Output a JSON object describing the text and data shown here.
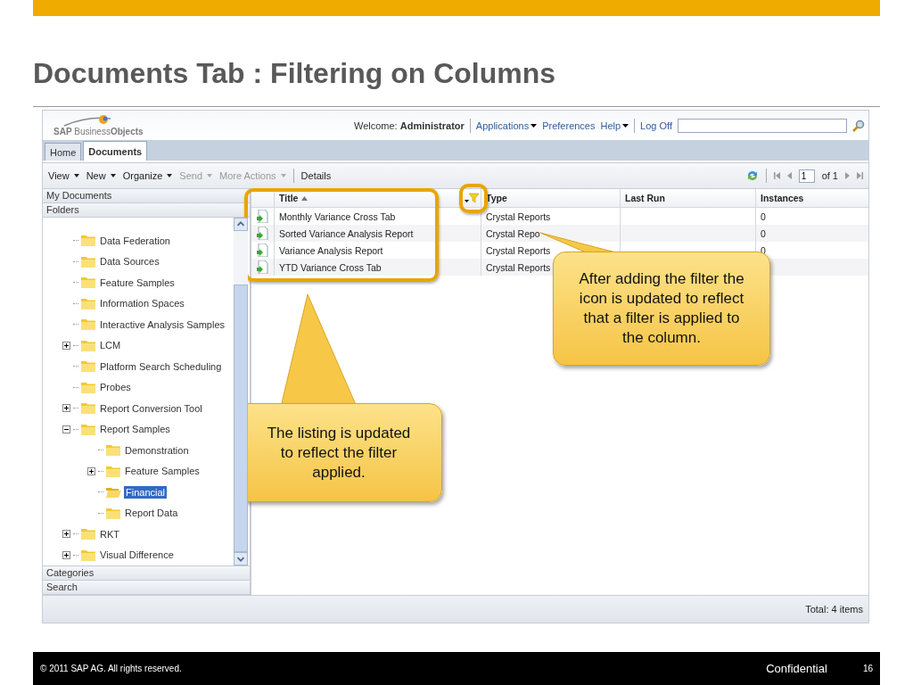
{
  "slide": {
    "title": "Documents Tab : Filtering on Columns"
  },
  "app": {
    "logo": "**SAP** Business**Objects**",
    "welcome": "Welcome: **Administrator**",
    "links": [
      {
        "label": "Applications",
        "menu": true
      },
      {
        "label": "Preferences",
        "menu": false
      },
      {
        "label": "Help",
        "menu": true
      },
      {
        "label": "Log Off",
        "menu": false
      }
    ],
    "tabs": [
      {
        "label": "Home",
        "selected": false
      },
      {
        "label": "Documents",
        "selected": true
      }
    ],
    "toolbar": {
      "actions": [
        {
          "label": "View",
          "disabled": false
        },
        {
          "label": "New",
          "disabled": false
        },
        {
          "label": "Organize",
          "disabled": false
        },
        {
          "label": "Send",
          "disabled": true
        },
        {
          "label": "More Actions",
          "disabled": true
        }
      ],
      "details": "Details",
      "page": "1",
      "page_count": "of 1"
    },
    "sections": {
      "top": [
        "My Documents",
        "Folders"
      ],
      "bottom": [
        "Categories",
        "Search"
      ]
    },
    "tree": [
      {
        "label": "Data Federation",
        "selected": false
      },
      {
        "label": "Data Sources",
        "selected": false
      },
      {
        "label": "Feature Samples",
        "selected": false
      },
      {
        "label": "Information Spaces",
        "selected": false
      },
      {
        "label": "Interactive Analysis Samples",
        "selected": false
      },
      {
        "label": "LCM",
        "expanded": false,
        "selected": false
      },
      {
        "label": "Platform Search Scheduling",
        "selected": false
      },
      {
        "label": "Probes",
        "selected": false
      },
      {
        "label": "Report Conversion Tool",
        "expanded": false,
        "selected": false
      },
      {
        "label": "Report Samples",
        "expanded": true,
        "selected": false,
        "children": [
          {
            "label": "Demonstration",
            "selected": false
          },
          {
            "label": "Feature Samples",
            "expanded": false,
            "selected": false
          },
          {
            "label": "Financial",
            "selected": true
          },
          {
            "label": "Report Data",
            "selected": false
          }
        ]
      },
      {
        "label": "RKT",
        "expanded": false,
        "selected": false
      },
      {
        "label": "Visual Difference",
        "expanded": false,
        "selected": false
      }
    ],
    "columns": [
      {
        "label": "Title",
        "sorted": true,
        "filtered": true
      },
      {
        "label": "Type",
        "sorted": false,
        "filtered": false
      },
      {
        "label": "Last Run",
        "sorted": false,
        "filtered": false
      },
      {
        "label": "Instances",
        "sorted": false,
        "filtered": false
      }
    ],
    "rows": [
      {
        "title": "Monthly Variance Cross Tab",
        "type": "Crystal Reports",
        "instances": "0"
      },
      {
        "title": "Sorted Variance Analysis Report",
        "type": "Crystal Repo",
        "instances": "0"
      },
      {
        "title": "Variance Analysis Report",
        "type": "Crystal Reports",
        "instances": "0"
      },
      {
        "title": "YTD Variance Cross Tab",
        "type": "Crystal Reports"
      }
    ],
    "status": "Total: 4 items"
  },
  "callouts": [
    {
      "text": "After adding the filter the icon is updated to reflect that a filter is applied to the column."
    },
    {
      "text": "The listing is updated to reflect the filter applied."
    }
  ],
  "footer": {
    "copyright": "© 2011 SAP AG. All rights reserved.",
    "classification": "Confidential",
    "page": "16"
  }
}
